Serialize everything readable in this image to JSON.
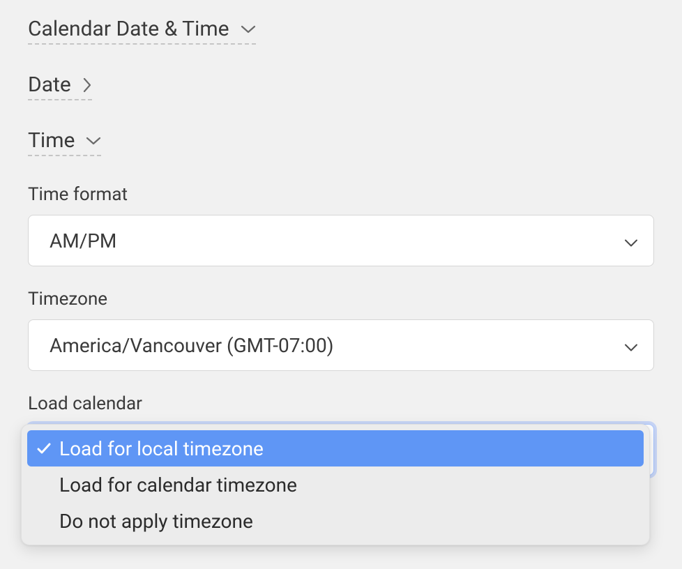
{
  "sections": {
    "calendar_date_time": "Calendar Date & Time",
    "date": "Date",
    "time": "Time"
  },
  "fields": {
    "time_format": {
      "label": "Time format",
      "value": "AM/PM"
    },
    "timezone": {
      "label": "Timezone",
      "value": "America/Vancouver (GMT-07:00)"
    },
    "load_calendar": {
      "label": "Load calendar",
      "options": [
        "Load for local timezone",
        "Load for calendar timezone",
        "Do not apply timezone"
      ],
      "selected_index": 0
    }
  }
}
